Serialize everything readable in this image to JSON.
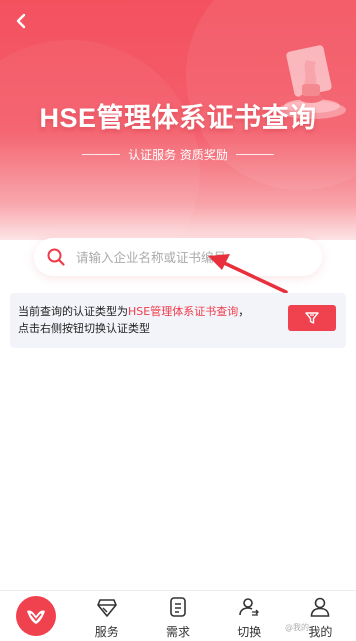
{
  "header": {
    "title": "HSE管理体系证书查询",
    "subtitle": "认证服务 资质奖励"
  },
  "search": {
    "placeholder": "请输入企业名称或证书编号",
    "value": ""
  },
  "info": {
    "prefix": "当前查询的认证类型为",
    "highlight": "HSE管理体系证书查询",
    "suffix": "，",
    "line2": "点击右侧按钮切换认证类型"
  },
  "tabbar": {
    "items": [
      {
        "label": "服务",
        "icon": "diamond-icon"
      },
      {
        "label": "需求",
        "icon": "document-icon"
      },
      {
        "label": "切换",
        "icon": "user-switch-icon"
      },
      {
        "label": "我的",
        "icon": "user-icon"
      }
    ]
  },
  "watermark": "@我的",
  "colors": {
    "primary": "#f0414f",
    "hero_top": "#f4515f",
    "info_bg": "#f3f4f9"
  }
}
